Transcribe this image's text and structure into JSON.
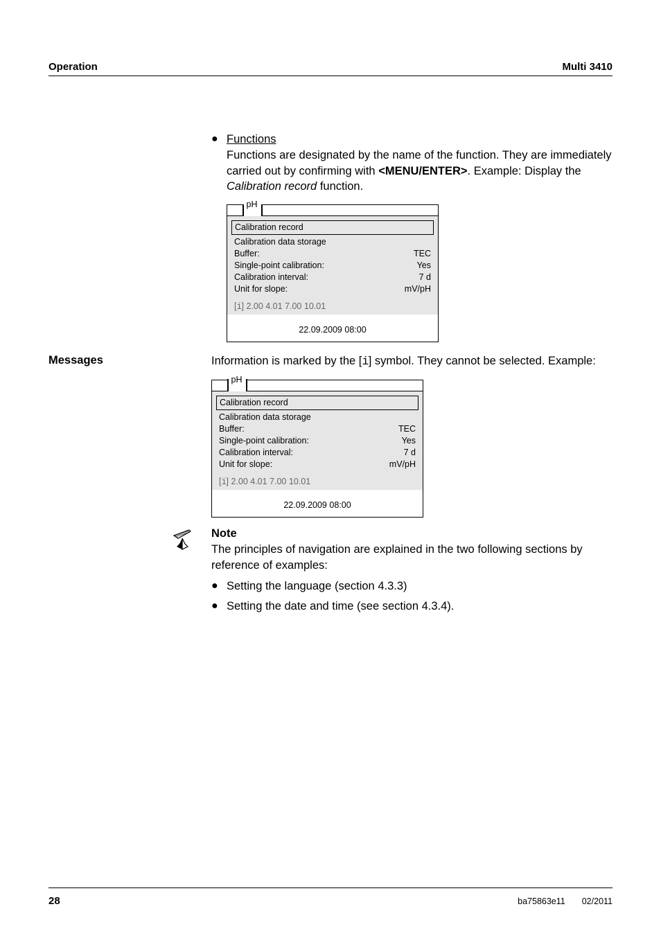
{
  "header": {
    "left": "Operation",
    "right": "Multi 3410"
  },
  "sec1": {
    "heading": "Functions",
    "para": "Functions are designated by the name of the function. They are immediately carried out by confirming with ",
    "key": "<MENU/ENTER>",
    "para2": ". Example: Display the ",
    "ital": "Calibration record",
    "para3": " function."
  },
  "screen": {
    "tab": "pH",
    "selected": "Calibration record",
    "rows": [
      {
        "l": "Calibration data storage",
        "r": ""
      },
      {
        "l": "Buffer:",
        "r": "TEC"
      },
      {
        "l": "Single-point calibration:",
        "r": "Yes"
      },
      {
        "l": "Calibration interval:",
        "r": "7 d"
      },
      {
        "l": "Unit for slope:",
        "r": "mV/pH"
      }
    ],
    "info_prefix": "[",
    "info_sym": "i",
    "info_suffix": "]",
    "info_rest": " 2.00 4.01 7.00 10.01",
    "footer": "22.09.2009 08:00"
  },
  "messages": {
    "label": "Messages",
    "text1": "Information is marked by the [",
    "sym": "i",
    "text2": "] symbol. They cannot be selected. Example:"
  },
  "note": {
    "heading": "Note",
    "text": "The principles of navigation are explained in the two following sections by reference of examples:"
  },
  "bullets": [
    "Setting the language (section 4.3.3)",
    "Setting the date and time (see section 4.3.4)."
  ],
  "footer": {
    "page": "28",
    "doc": "ba75863e11",
    "date": "02/2011"
  }
}
